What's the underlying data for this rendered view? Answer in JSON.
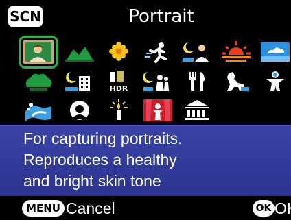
{
  "header": {
    "badge": "SCN",
    "title": "Portrait"
  },
  "scene_icons": [
    {
      "name": "portrait-icon",
      "selected": true
    },
    {
      "name": "landscape-icon"
    },
    {
      "name": "flower-icon"
    },
    {
      "name": "sports-icon"
    },
    {
      "name": "night-portrait-icon"
    },
    {
      "name": "sunset-icon"
    },
    {
      "name": "blue-sky-icon"
    },
    {
      "name": "forest-icon"
    },
    {
      "name": "night-scene-icon"
    },
    {
      "name": "night-scene-hdr-icon",
      "text": "HDR"
    },
    {
      "name": "kids-night-icon"
    },
    {
      "name": "food-icon"
    },
    {
      "name": "pet-icon"
    },
    {
      "name": "kids-icon"
    },
    {
      "name": "surf-snow-icon"
    },
    {
      "name": "backlight-silhouette-icon"
    },
    {
      "name": "candlelight-icon"
    },
    {
      "name": "stage-lighting-icon"
    },
    {
      "name": "museum-icon"
    }
  ],
  "description": {
    "lines": [
      "For capturing portraits.",
      "Reproduces a healthy",
      "and bright skin tone"
    ]
  },
  "footer": {
    "menu_badge": "MENU",
    "cancel": "Cancel",
    "ok_badge": "OK",
    "ok": "OK"
  },
  "colors": {
    "selection": "#27b34a",
    "panel": "#323a9c"
  }
}
